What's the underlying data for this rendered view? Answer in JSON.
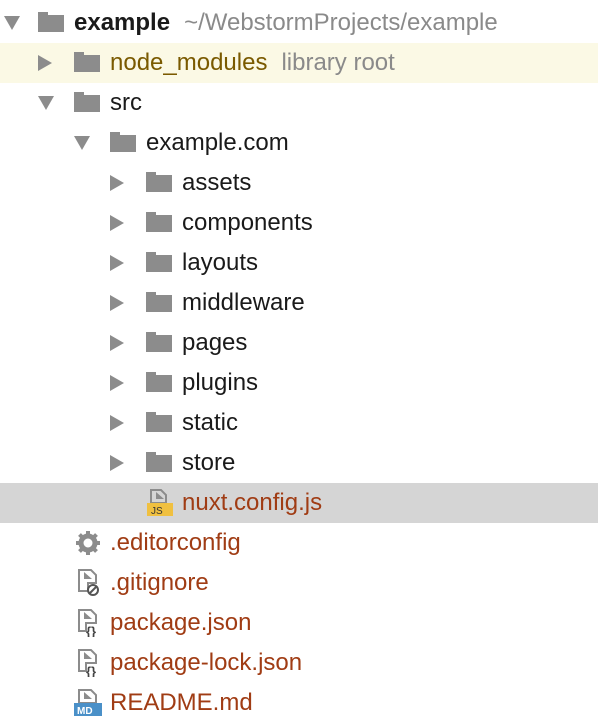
{
  "root": {
    "name": "example",
    "path": "~/WebstormProjects/example"
  },
  "node_modules": {
    "name": "node_modules",
    "hint": "library root"
  },
  "src": {
    "name": "src"
  },
  "domain_folder": {
    "name": "example.com"
  },
  "folders": [
    "assets",
    "components",
    "layouts",
    "middleware",
    "pages",
    "plugins",
    "static",
    "store"
  ],
  "nuxt_config": {
    "name": "nuxt.config.js",
    "badge": "JS"
  },
  "files": [
    {
      "name": ".editorconfig",
      "icon": "gear-icon"
    },
    {
      "name": ".gitignore",
      "icon": "ignore-file-icon"
    },
    {
      "name": "package.json",
      "icon": "json-file-icon"
    },
    {
      "name": "package-lock.json",
      "icon": "json-file-icon"
    },
    {
      "name": "README.md",
      "icon": "markdown-file-icon",
      "badge": "MD"
    }
  ],
  "colors": {
    "library_row_bg": "#fbf9e5",
    "selected_row_bg": "#d5d5d5",
    "file_text": "#a03c14",
    "folder_icon": "#8c8c8c"
  }
}
